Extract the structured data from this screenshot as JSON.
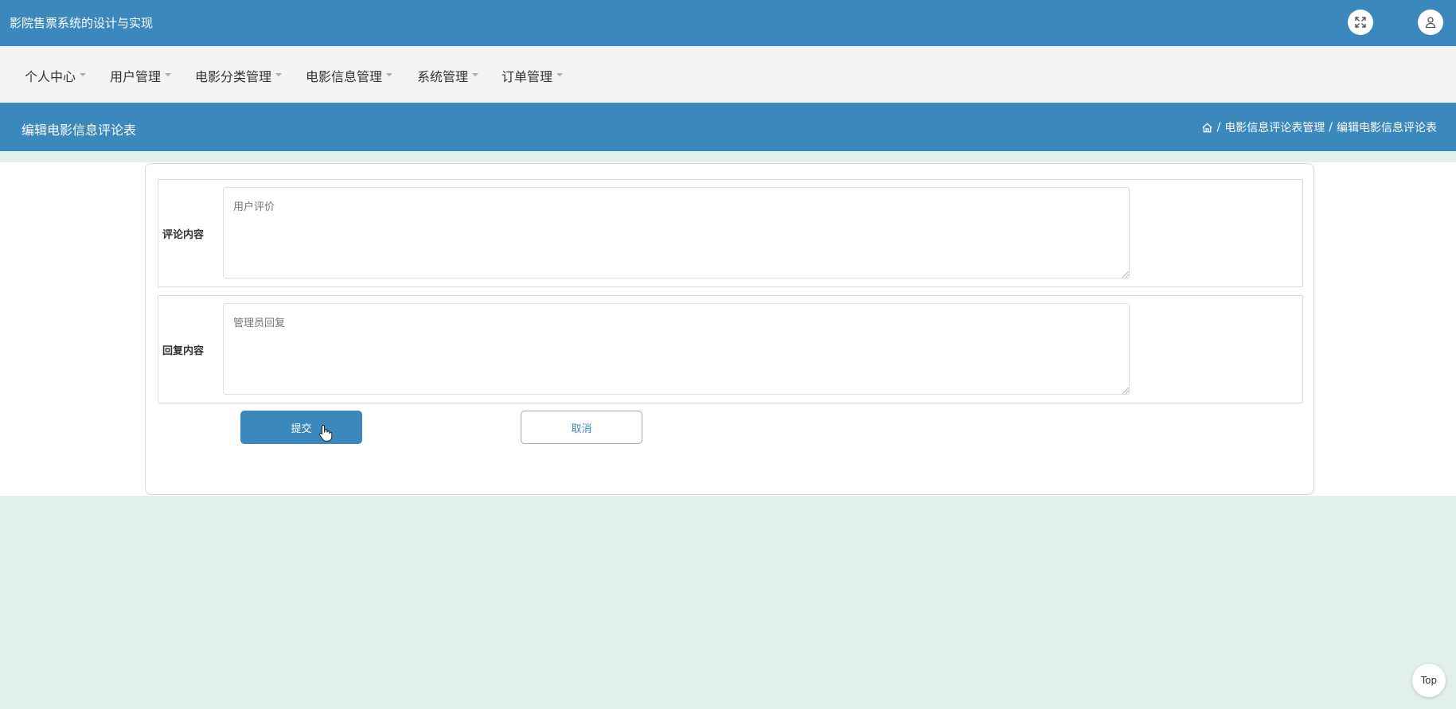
{
  "app": {
    "title": "影院售票系统的设计与实现"
  },
  "header": {
    "fullscreen_icon": "expand-icon",
    "user_icon": "user-icon"
  },
  "nav": {
    "items": [
      {
        "label": "个人中心"
      },
      {
        "label": "用户管理"
      },
      {
        "label": "电影分类管理"
      },
      {
        "label": "电影信息管理"
      },
      {
        "label": "系统管理"
      },
      {
        "label": "订单管理"
      }
    ]
  },
  "page": {
    "title": "编辑电影信息评论表",
    "breadcrumb": {
      "home_icon": "home-icon",
      "items": [
        "电影信息评论表管理",
        "编辑电影信息评论表"
      ],
      "separator": "/"
    }
  },
  "form": {
    "fields": [
      {
        "label": "评论内容",
        "placeholder": "用户评价",
        "value": ""
      },
      {
        "label": "回复内容",
        "placeholder": "管理员回复",
        "value": ""
      }
    ],
    "submit_label": "提交",
    "cancel_label": "取消"
  },
  "back_to_top": {
    "label": "Top"
  },
  "colors": {
    "primary": "#3b88bd",
    "nav_bg": "#f4f4f4",
    "page_bg": "#e2f0ec"
  }
}
